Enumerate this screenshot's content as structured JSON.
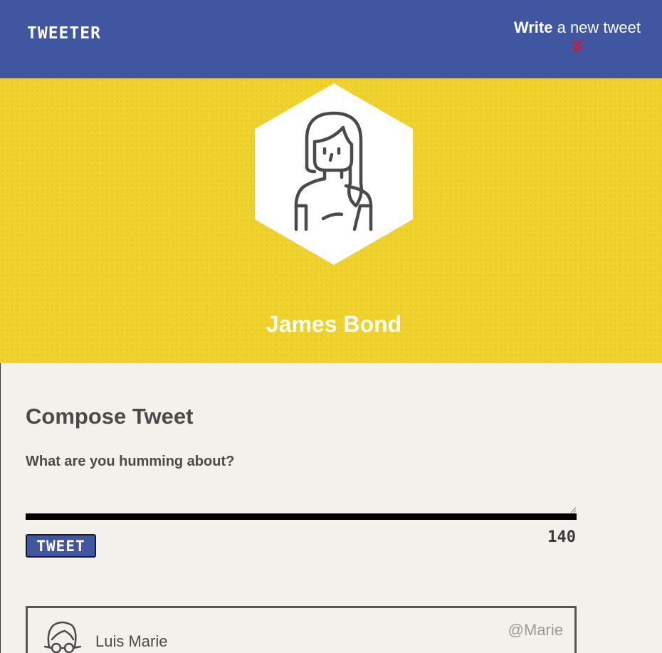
{
  "nav": {
    "brand": "TWEETER",
    "compose_link_bold": "Write",
    "compose_link_rest": " a new tweet"
  },
  "profile": {
    "name": "James Bond"
  },
  "compose": {
    "title": "Compose Tweet",
    "prompt": "What are you humming about?",
    "input_value": "",
    "button_label": "TWEET",
    "char_counter": "140"
  },
  "tweets": [
    {
      "name": "Luis Marie",
      "handle": "@Marie"
    }
  ],
  "colors": {
    "nav_bg": "#4056a1",
    "hero_bg": "#f0d22c",
    "page_bg": "#f4f1ec",
    "chevron": "#e0102a"
  },
  "icons": {
    "profile_avatar": "woman-avatar-icon",
    "tweet_avatar": "man-with-glasses-avatar-icon",
    "compose_chevron": "double-chevron-down-icon"
  }
}
